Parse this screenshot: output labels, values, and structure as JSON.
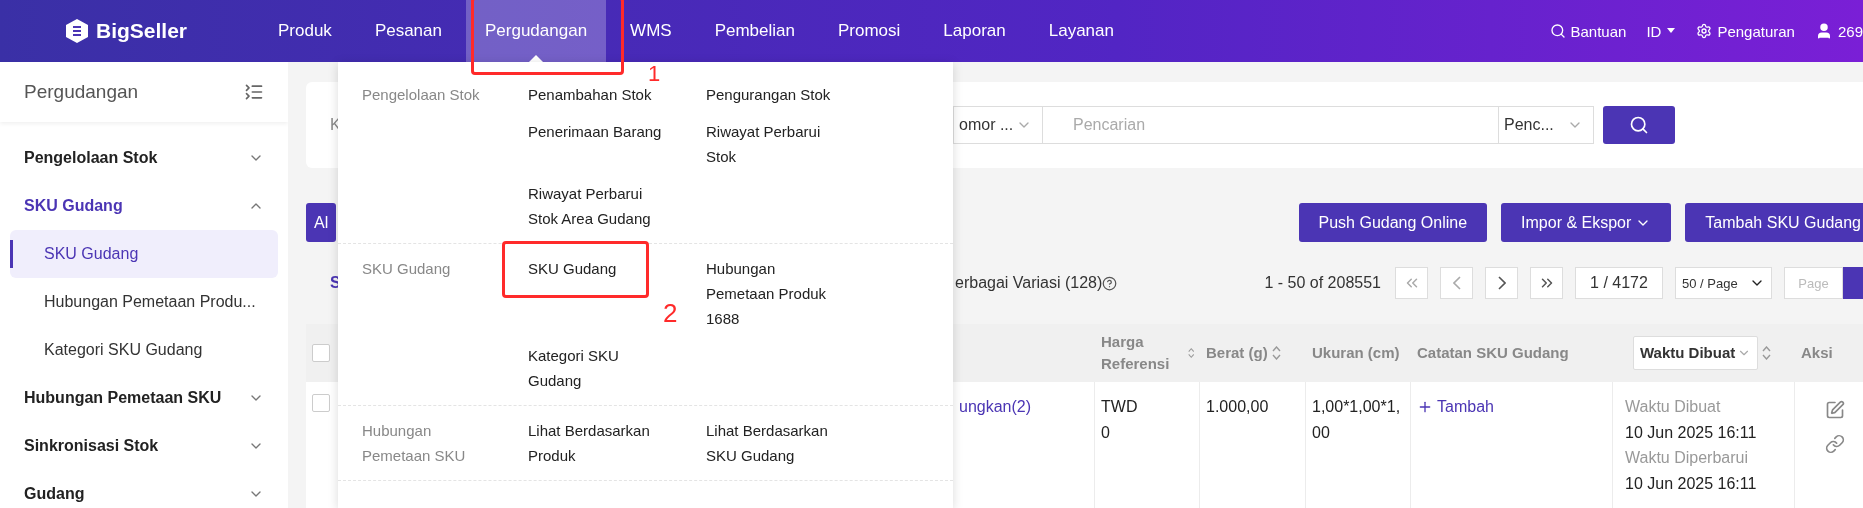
{
  "top_nav": {
    "logo": "BigSeller",
    "items": [
      {
        "label": "Produk",
        "selected": false
      },
      {
        "label": "Pesanan",
        "selected": false
      },
      {
        "label": "Pergudangan",
        "selected": true
      },
      {
        "label": "WMS",
        "selected": false
      },
      {
        "label": "Pembelian",
        "selected": false
      },
      {
        "label": "Promosi",
        "selected": false
      },
      {
        "label": "Laporan",
        "selected": false
      },
      {
        "label": "Layanan",
        "selected": false
      }
    ],
    "help": "Bantuan",
    "language": "ID",
    "settings": "Pengaturan",
    "user": "269"
  },
  "sidebar": {
    "title": "Pergudangan",
    "items": [
      {
        "label": "Pengelolaan Stok",
        "expanded": false
      },
      {
        "label": "SKU Gudang",
        "expanded": true,
        "children": [
          {
            "label": "SKU Gudang",
            "selected": true
          },
          {
            "label": "Hubungan Pemetaan Produ...",
            "selected": false
          },
          {
            "label": "Kategori SKU Gudang",
            "selected": false
          }
        ]
      },
      {
        "label": "Hubungan Pemetaan SKU",
        "expanded": false
      },
      {
        "label": "Sinkronisasi Stok",
        "expanded": false
      },
      {
        "label": "Gudang",
        "expanded": false
      }
    ]
  },
  "filter": {
    "label": "K",
    "type_select": "omor ...",
    "search_placeholder": "Pencarian",
    "mode_select": "Penc..."
  },
  "actions": {
    "left_button": "Al",
    "buttons": [
      {
        "label": "Push Gudang Online",
        "kind": "plain"
      },
      {
        "label": "Impor & Ekspor",
        "kind": "menu"
      },
      {
        "label": "Tambah SKU Gudang",
        "kind": "plain"
      }
    ]
  },
  "list_bar": {
    "tab": "S",
    "variant_note": "erbagai Variasi (128)",
    "range": "1 - 50 of 208551",
    "page": "1 / 4172",
    "page_size": "50 / Page",
    "page_placeholder": "Page"
  },
  "table": {
    "header_checked": false,
    "columns": [
      {
        "label": "Harga Referensi",
        "kind": "sortable"
      },
      {
        "label": "Berat (g)",
        "kind": "sortable"
      },
      {
        "label": "Ukuran (cm)",
        "kind": "text"
      },
      {
        "label": "Catatan SKU Gudang",
        "kind": "text"
      },
      {
        "label": "Waktu Dibuat",
        "kind": "select"
      },
      {
        "label": "Aksi",
        "kind": "text"
      }
    ],
    "rows": [
      {
        "checked": false,
        "column_1": "ungkan(2)",
        "price_currency": "TWD",
        "price": "0",
        "weight": "1.000,00",
        "size": "1,00*1,00*1,00",
        "note_action": "Tambah",
        "created_label": "Waktu Dibuat",
        "created": "10 Jun 2025 16:11",
        "updated_label": "Waktu Diperbarui",
        "updated": "10 Jun 2025 16:11"
      }
    ]
  },
  "menu": {
    "groups": [
      {
        "label": "Pengelolaan Stok",
        "items": [
          "Penambahan Stok",
          "Pengurangan Stok",
          "Penerimaan Barang",
          "Riwayat Perbarui Stok",
          "Riwayat Perbarui Stok Area Gudang"
        ]
      },
      {
        "label": "SKU Gudang",
        "items": [
          "SKU Gudang",
          "Hubungan Pemetaan Produk 1688",
          "Kategori SKU Gudang"
        ]
      },
      {
        "label": "Hubungan Pemetaan SKU",
        "items": [
          "Lihat Berdasarkan Produk",
          "Lihat Berdasarkan SKU Gudang"
        ]
      }
    ]
  },
  "annotations": [
    {
      "label": "1"
    },
    {
      "label": "2"
    }
  ]
}
